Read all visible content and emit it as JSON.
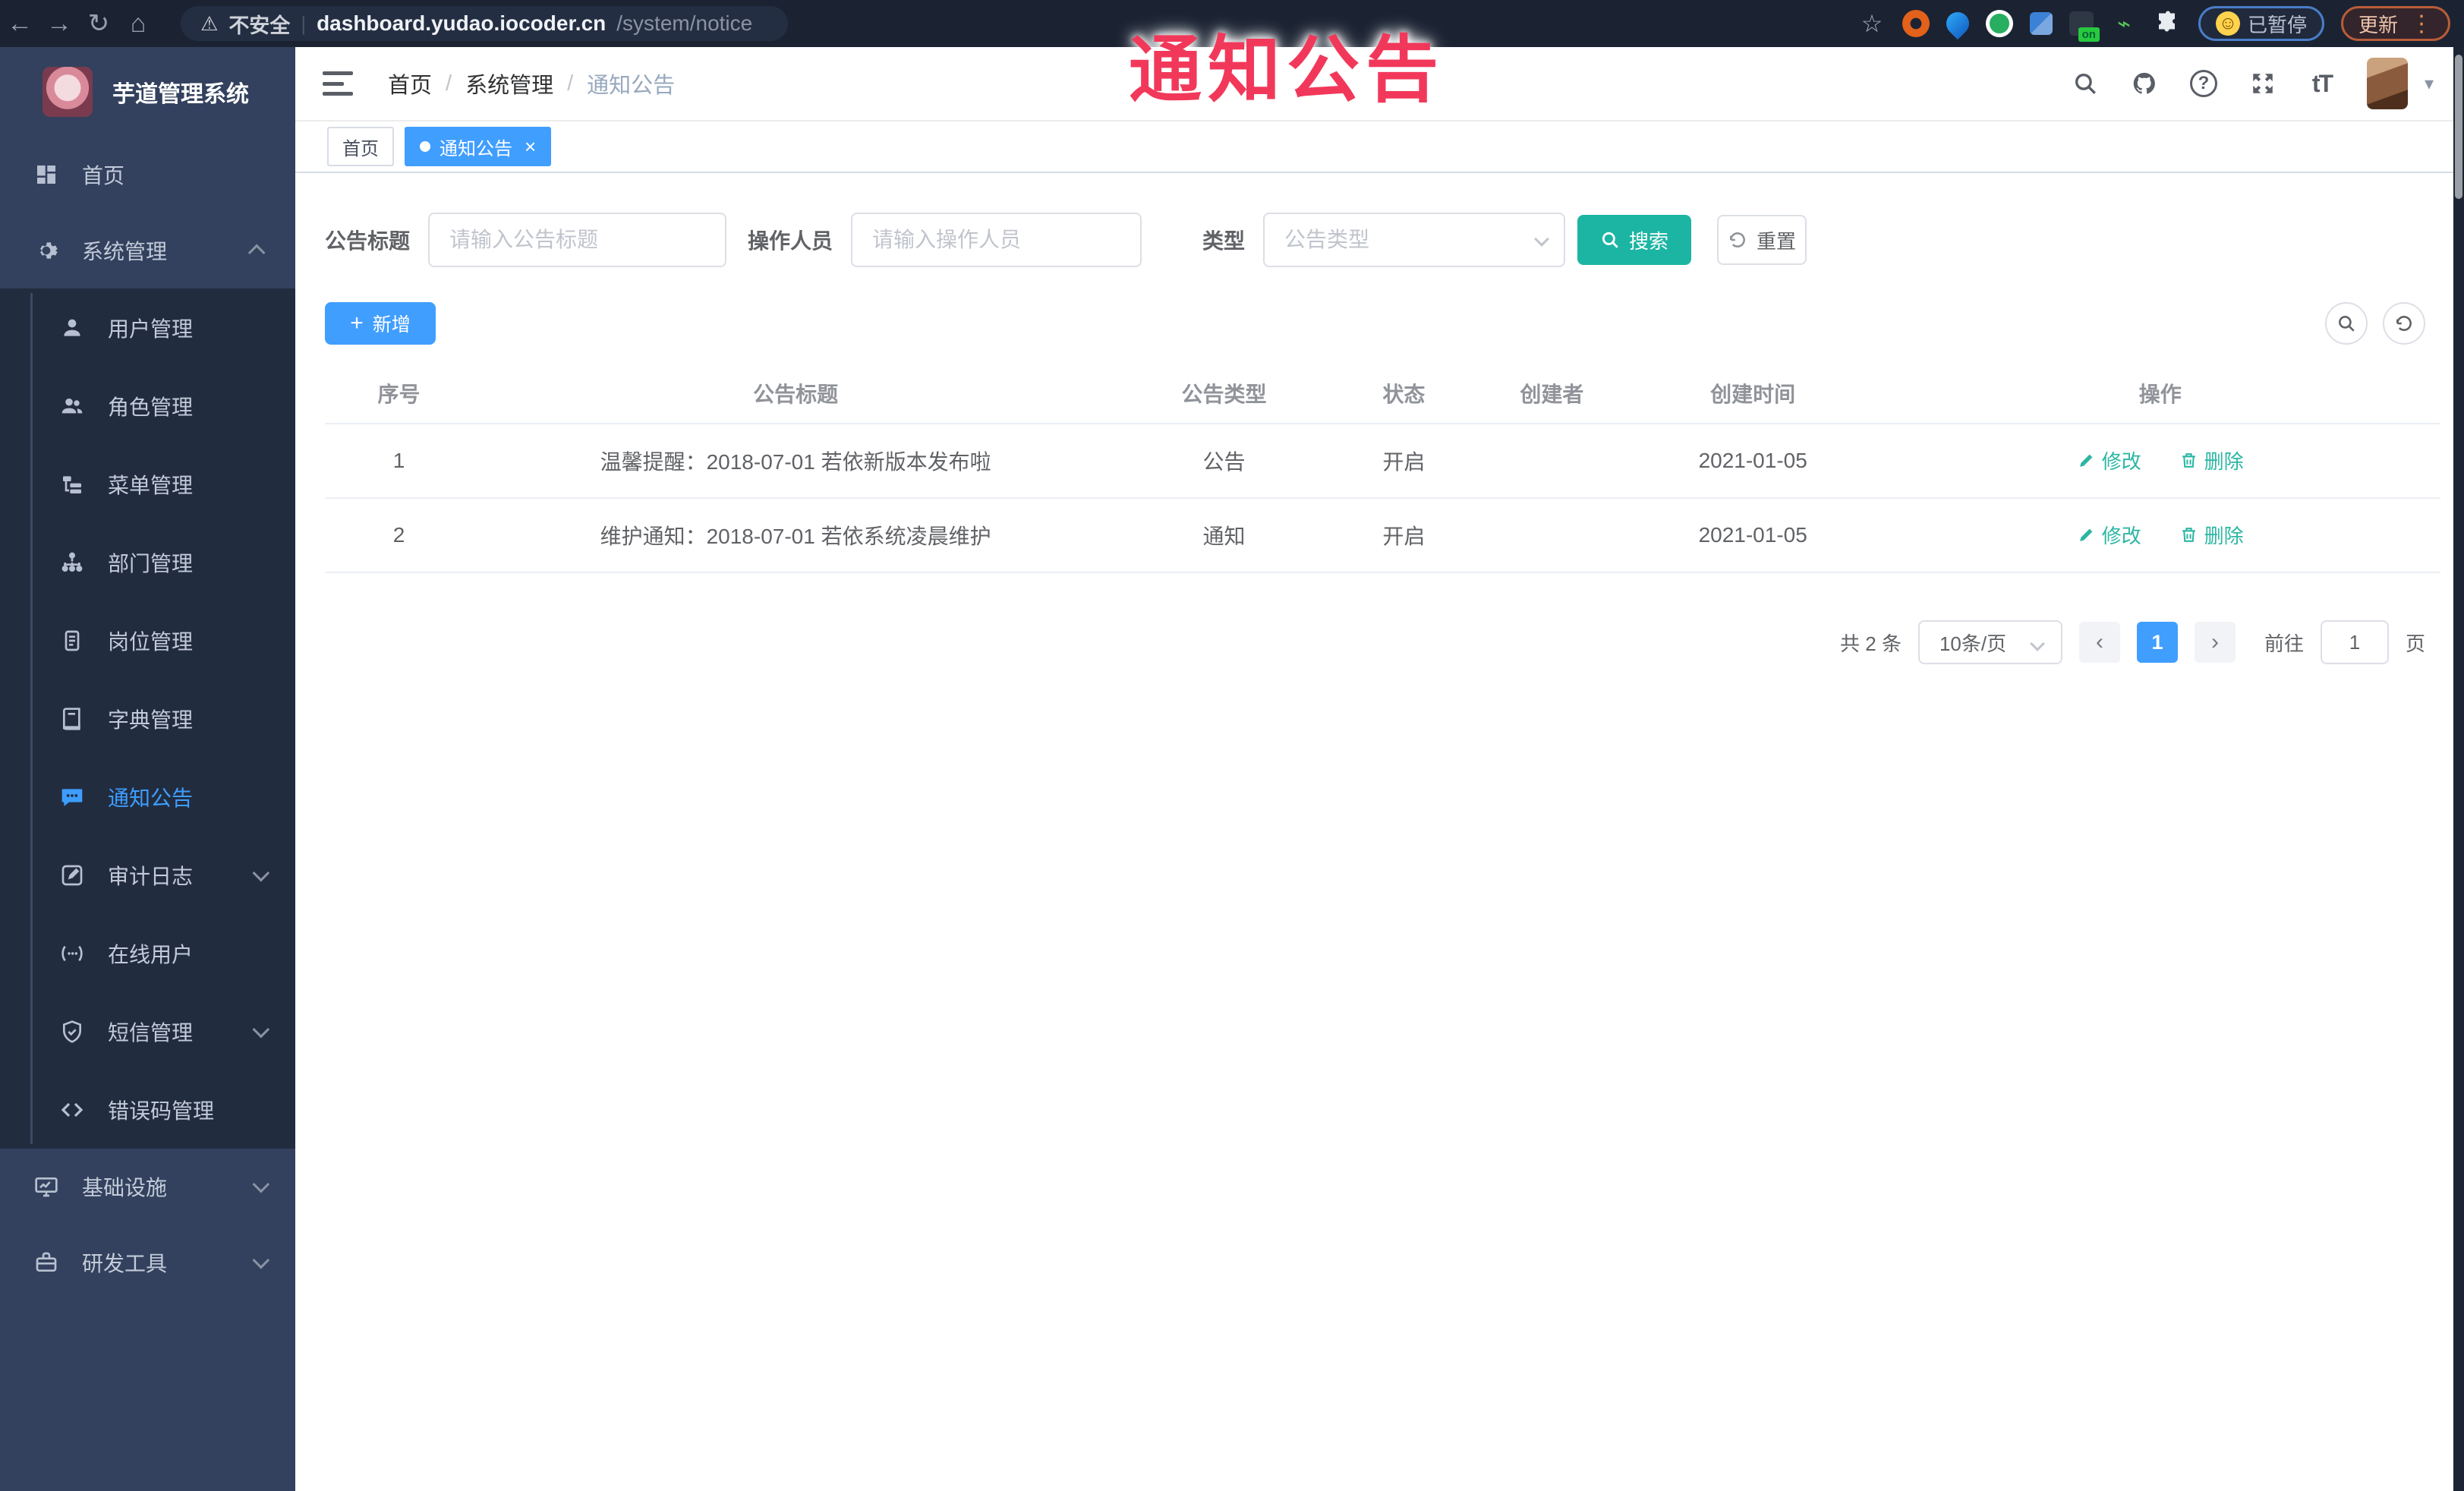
{
  "browser": {
    "security_label": "不安全",
    "url_host": "dashboard.yudao.iocoder.cn",
    "url_path": "/system/notice",
    "extension_badge": "on",
    "paused_label": "已暂停",
    "update_label": "更新"
  },
  "overlay": {
    "text": "通知公告"
  },
  "sidebar": {
    "title": "芋道管理系统",
    "items": [
      {
        "label": "首页"
      },
      {
        "label": "系统管理"
      },
      {
        "label": "用户管理"
      },
      {
        "label": "角色管理"
      },
      {
        "label": "菜单管理"
      },
      {
        "label": "部门管理"
      },
      {
        "label": "岗位管理"
      },
      {
        "label": "字典管理"
      },
      {
        "label": "通知公告"
      },
      {
        "label": "审计日志"
      },
      {
        "label": "在线用户"
      },
      {
        "label": "短信管理"
      },
      {
        "label": "错误码管理"
      },
      {
        "label": "基础设施"
      },
      {
        "label": "研发工具"
      }
    ]
  },
  "header": {
    "breadcrumb": [
      "首页",
      "系统管理",
      "通知公告"
    ]
  },
  "tags": [
    {
      "label": "首页"
    },
    {
      "label": "通知公告"
    }
  ],
  "search": {
    "title_label": "公告标题",
    "title_placeholder": "请输入公告标题",
    "operator_label": "操作人员",
    "operator_placeholder": "请输入操作人员",
    "type_label": "类型",
    "type_placeholder": "公告类型",
    "search_button": "搜索",
    "reset_button": "重置"
  },
  "toolbar": {
    "add_button": "新增"
  },
  "table": {
    "columns": [
      "序号",
      "公告标题",
      "公告类型",
      "状态",
      "创建者",
      "创建时间",
      "操作"
    ],
    "edit_label": "修改",
    "delete_label": "删除",
    "rows": [
      {
        "no": "1",
        "title": "温馨提醒：2018-07-01 若依新版本发布啦",
        "type": "公告",
        "status": "开启",
        "creator": "",
        "created": "2021-01-05"
      },
      {
        "no": "2",
        "title": "维护通知：2018-07-01 若依系统凌晨维护",
        "type": "通知",
        "status": "开启",
        "creator": "",
        "created": "2021-01-05"
      }
    ]
  },
  "pagination": {
    "total_text": "共 2 条",
    "page_size": "10条/页",
    "prev": "‹",
    "next": "›",
    "current_page": "1",
    "jump_prefix": "前往",
    "jump_value": "1",
    "jump_suffix": "页"
  },
  "colors": {
    "accent": "#409eff",
    "teal": "#1cb5a3",
    "overlay_red": "#f2385a",
    "sidebar_bg": "#33415e",
    "submenu_bg": "#222c3f"
  }
}
